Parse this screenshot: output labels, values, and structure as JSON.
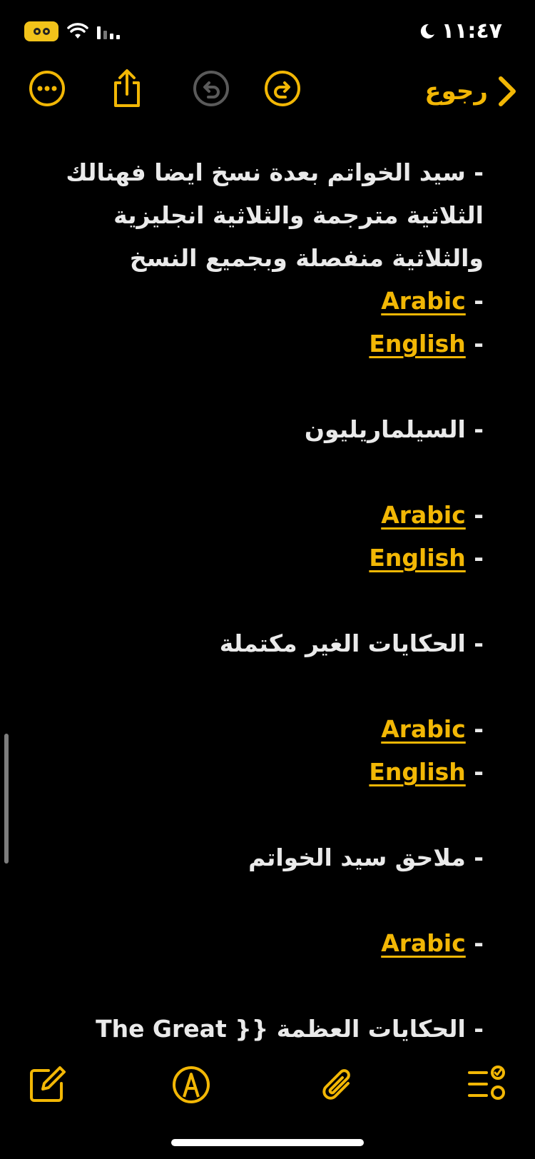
{
  "status_bar": {
    "time": "١١:٤٧"
  },
  "toolbar": {
    "back_label": "رجوع"
  },
  "note": {
    "lines": [
      "- سيد الخواتم بعدة نسخ ايضا فهنالك",
      "الثلاثية مترجمة والثلاثية انجليزية",
      "والثلاثية منفصلة وبجميع النسخ",
      "Arabic",
      "English ",
      "- السيلماريليون",
      "Arabic",
      "English",
      "- الحكايات الغير مكتملة",
      "Arabic",
      "English ",
      "- ملاحق سيد الخواتم",
      "Arabic",
      "- الحكايات العظمة {{ The Great"
    ],
    "dash": "-"
  },
  "colors": {
    "accent": "#f2b705",
    "background": "#000000",
    "text": "#eaeaea"
  },
  "icons": {
    "more": "ellipsis-circle-icon",
    "share": "share-icon",
    "undo": "undo-icon",
    "redo": "redo-icon",
    "back": "chevron-right-icon",
    "compose": "compose-icon",
    "markup": "pen-circle-icon",
    "attach": "paperclip-icon",
    "checklist": "checklist-icon"
  }
}
